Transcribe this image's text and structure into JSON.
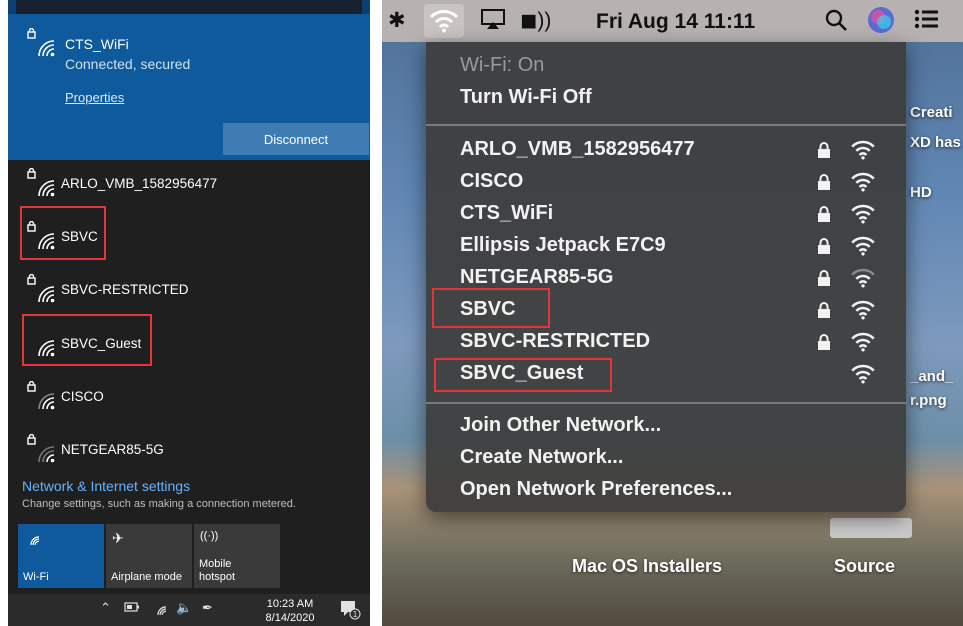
{
  "windows": {
    "connected": {
      "ssid": "CTS_WiFi",
      "status": "Connected, secured",
      "properties_link": "Properties",
      "disconnect_button": "Disconnect"
    },
    "networks": [
      {
        "ssid": "ARLO_VMB_1582956477",
        "secured": true
      },
      {
        "ssid": "SBVC",
        "secured": true
      },
      {
        "ssid": "SBVC-RESTRICTED",
        "secured": true
      },
      {
        "ssid": "SBVC_Guest",
        "secured": false
      },
      {
        "ssid": "CISCO",
        "secured": true
      },
      {
        "ssid": "NETGEAR85-5G",
        "secured": true
      }
    ],
    "settings_link": "Network & Internet settings",
    "settings_subtitle": "Change settings, such as making a connection metered.",
    "quick_actions": [
      {
        "label": "Wi-Fi",
        "icon": "wifi-icon",
        "active": true
      },
      {
        "label": "Airplane mode",
        "icon": "airplane-icon",
        "active": false
      },
      {
        "label_line1": "Mobile",
        "label_line2": "hotspot",
        "icon": "hotspot-icon",
        "active": false
      }
    ],
    "taskbar": {
      "time": "10:23 AM",
      "date": "8/14/2020",
      "notification_count": "1"
    },
    "colors": {
      "accent": "#0e5a9c",
      "button": "#3f7cb4",
      "link": "#67b2ff",
      "highlight_box": "#e2353b"
    }
  },
  "mac": {
    "menubar": {
      "datetime": "Fri Aug 14  11:11"
    },
    "menu": {
      "wifi_status": "Wi-Fi: On",
      "toggle": "Turn Wi-Fi Off",
      "networks": [
        {
          "ssid": "ARLO_VMB_1582956477",
          "secured": true
        },
        {
          "ssid": "CISCO",
          "secured": true
        },
        {
          "ssid": "CTS_WiFi",
          "secured": true
        },
        {
          "ssid": "Ellipsis Jetpack E7C9",
          "secured": true
        },
        {
          "ssid": "NETGEAR85-5G",
          "secured": true
        },
        {
          "ssid": "SBVC",
          "secured": true
        },
        {
          "ssid": "SBVC-RESTRICTED",
          "secured": true
        },
        {
          "ssid": "SBVC_Guest",
          "secured": false
        }
      ],
      "join_other": "Join Other Network...",
      "create": "Create Network...",
      "open_prefs": "Open Network Preferences..."
    },
    "desktop": {
      "items": [
        "Mac OS Installers",
        "Source"
      ],
      "side_text": [
        "Creati",
        "XD has",
        "HD",
        "_and_",
        "r.png"
      ]
    }
  }
}
